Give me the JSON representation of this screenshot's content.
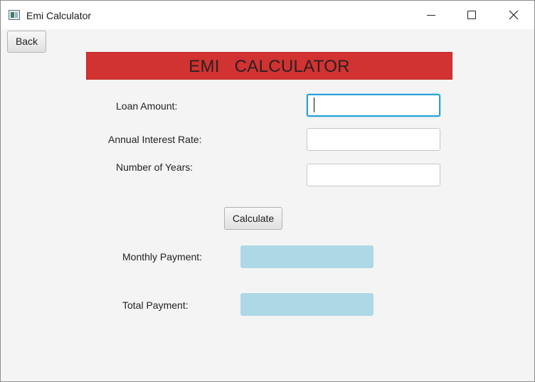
{
  "window": {
    "title": "Emi Calculator",
    "icon": "app-window-icon",
    "controls": [
      "minimize-icon",
      "maximize-icon",
      "close-icon"
    ]
  },
  "toolbar": {
    "back_label": "Back"
  },
  "banner": {
    "title": "EMI   CALCULATOR",
    "color": "#d13232"
  },
  "form": {
    "loan_amount": {
      "label": "Loan Amount:",
      "value": ""
    },
    "interest_rate": {
      "label": "Annual Interest Rate:",
      "value": ""
    },
    "years": {
      "label": "Number of Years:",
      "value": ""
    },
    "calculate_label": "Calculate"
  },
  "results": {
    "monthly": {
      "label": "Monthly Payment:",
      "value": ""
    },
    "total": {
      "label": "Total Payment:",
      "value": ""
    },
    "field_color": "#add8e6"
  },
  "colors": {
    "focus_border": "#2a9fd6",
    "background": "#f4f4f4"
  }
}
